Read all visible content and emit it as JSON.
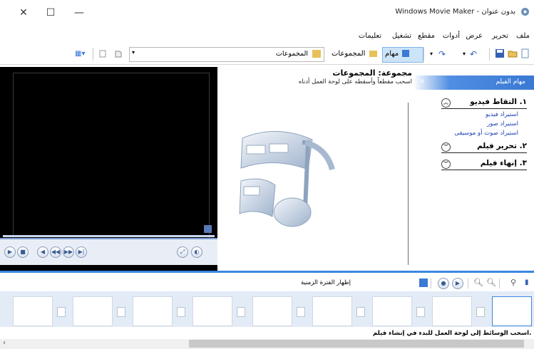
{
  "window": {
    "title": "Windows Movie Maker - بدون عنوان",
    "close_glyph": "✕",
    "maximize_glyph": "☐",
    "minimize_glyph": "—"
  },
  "menu": {
    "items": [
      "ملف",
      "تحرير",
      "عرض",
      "أدوات",
      "مقطع",
      "تشغيل",
      "تعليمات"
    ]
  },
  "toolbar": {
    "undo_glyph": "↶",
    "redo_glyph": "↷",
    "tasks_label": "مهام",
    "collections_label": "المجموعات",
    "combo_value": "المجموعات",
    "view_glyph": "▦▾"
  },
  "collection": {
    "title": "مجموعة: المجموعات",
    "subtitle": "اسحب مقطعاً وأسقطه على لوحة العمل أدناه"
  },
  "tasks": {
    "header": "مهام الفيلم",
    "close_glyph": "×",
    "sections": [
      {
        "number": "١.",
        "label": "التقاط فيديو",
        "expanded": true,
        "links": [
          "استيراد فيديو",
          "استيراد صور",
          "استيراد صوت أو موسيقى"
        ]
      },
      {
        "number": "٢.",
        "label": "تحرير فيلم",
        "expanded": false,
        "links": []
      },
      {
        "number": "٣.",
        "label": "إنهاء فيلم",
        "expanded": false,
        "links": []
      }
    ]
  },
  "player": {
    "buttons": [
      "▶",
      "■",
      "◀",
      "◀◀",
      "▶▶",
      "▶|",
      "⤢",
      "◐"
    ]
  },
  "storyboard": {
    "timeline_label": "إظهار الفترة الزمنية",
    "drag_hint": "اسحب الوسائط إلى لوحة العمل للبدء في إنشاء فيلم.",
    "slot_count": 9
  },
  "colors": {
    "accent": "#3b86e0",
    "link": "#1a3fb8",
    "preview_bg": "#000000",
    "storyboard_bg": "#e3ebf7"
  }
}
